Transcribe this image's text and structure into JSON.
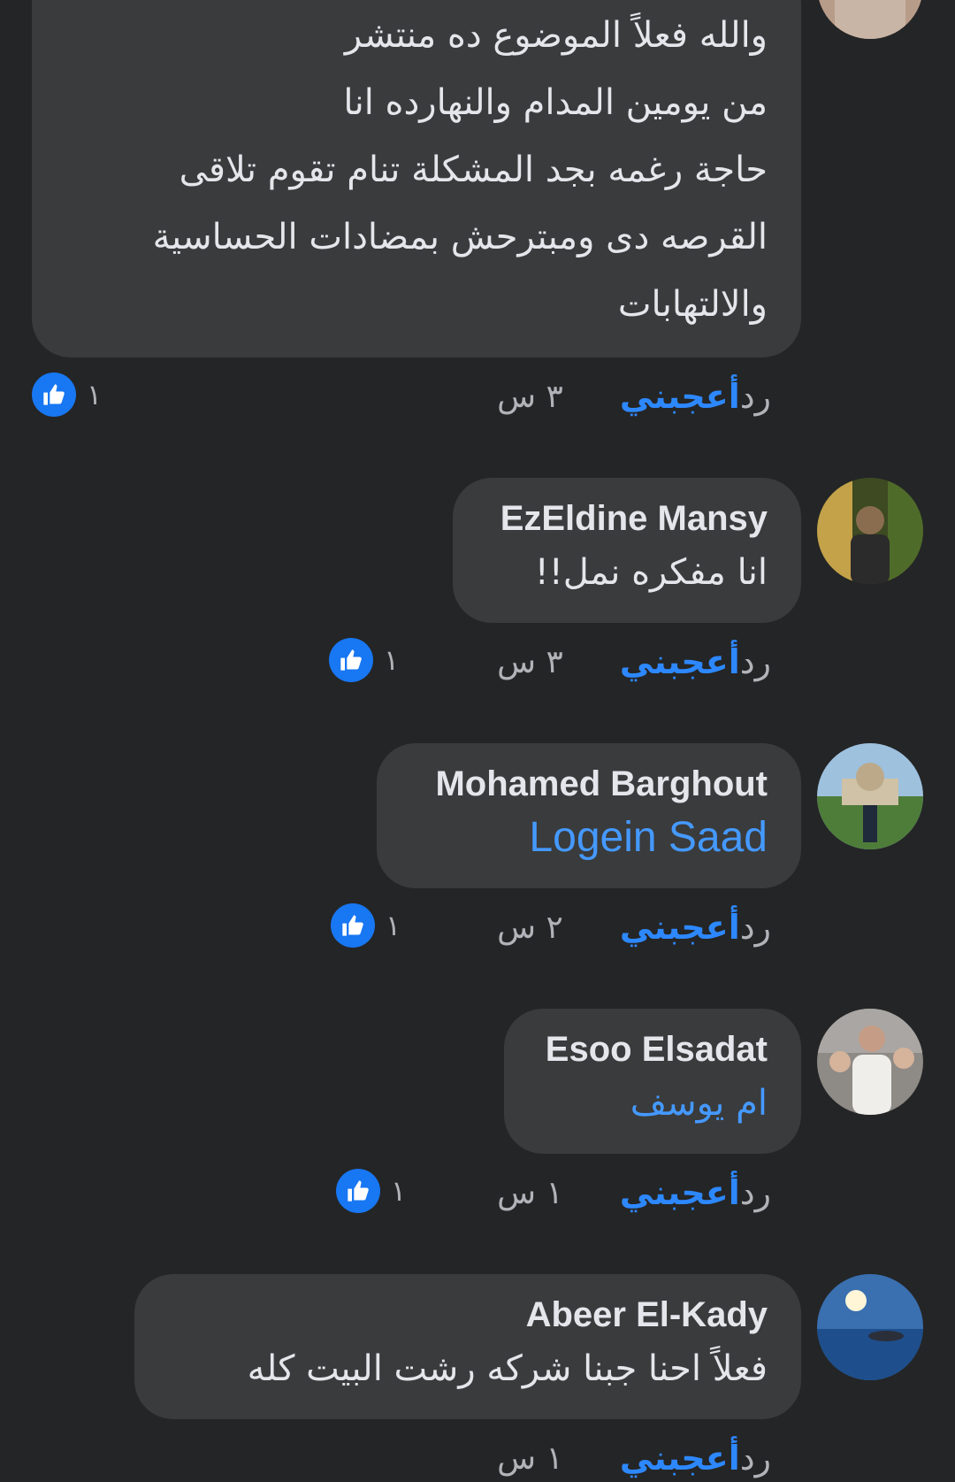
{
  "comments": [
    {
      "author": "",
      "lines": [
        "والله فعلاً الموضوع ده منتشر",
        "من يومين المدام والنهارده انا",
        "حاجة رغمه بجد المشكلة تنام تقوم تلاقى",
        "القرصه دى ومبترحش بمضادات الحساسية",
        "والالتهابات"
      ],
      "time": "٣ س",
      "like_label": "أعجبني",
      "reply_label": "رد",
      "reaction_count": "١"
    },
    {
      "author": "EzEldine Mansy",
      "text": "انا مفكره نمل!!",
      "time": "٣ س",
      "like_label": "أعجبني",
      "reply_label": "رد",
      "reaction_count": "١"
    },
    {
      "author": "Mohamed Barghout",
      "mention": "Logein Saad",
      "time": "٢ س",
      "like_label": "أعجبني",
      "reply_label": "رد",
      "reaction_count": "١"
    },
    {
      "author": "Esoo Elsadat",
      "mention": "ام يوسف",
      "time": "١ س",
      "like_label": "أعجبني",
      "reply_label": "رد",
      "reaction_count": "١"
    },
    {
      "author": "Abeer El-Kady",
      "text": "فعلاً احنا جبنا شركه رشت البيت كله",
      "time": "١ س",
      "like_label": "أعجبني",
      "reply_label": "رد"
    }
  ],
  "colors": {
    "background": "#242526",
    "bubble": "#3a3b3c",
    "text": "#e4e6eb",
    "muted": "#b0b3b8",
    "link": "#2d88ff",
    "like_badge": "#1877f2"
  },
  "icons": [
    "thumbs-up-icon"
  ]
}
